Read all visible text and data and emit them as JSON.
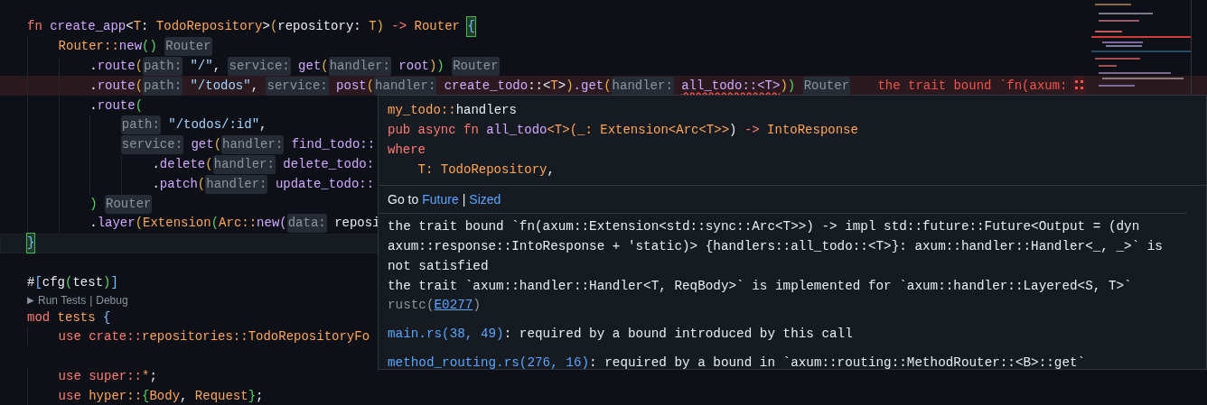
{
  "editor": {
    "lines": [
      {
        "kind": "code",
        "error": false,
        "current": false,
        "tokens": [
          {
            "text": "fn ",
            "kind": "kw"
          },
          {
            "text": "create_app",
            "kind": "fn"
          },
          {
            "text": "<",
            "kind": "p"
          },
          {
            "text": "T",
            "kind": "ty"
          },
          {
            "text": ": ",
            "kind": "p"
          },
          {
            "text": "TodoRepository",
            "kind": "ty"
          },
          {
            "text": ">",
            "kind": "p"
          },
          {
            "text": "(",
            "kind": "g"
          },
          {
            "text": "repository: ",
            "kind": "p"
          },
          {
            "text": "T",
            "kind": "ty"
          },
          {
            "text": ") ",
            "kind": "g"
          },
          {
            "text": "-> ",
            "kind": "kw"
          },
          {
            "text": "Router ",
            "kind": "ty"
          },
          {
            "text": "{",
            "kind": "hl"
          }
        ]
      },
      {
        "kind": "code",
        "error": false,
        "current": false,
        "tokens": [
          {
            "text": "    Router::",
            "kind": "ty"
          },
          {
            "text": "new",
            "kind": "fn"
          },
          {
            "text": "() ",
            "kind": "gr"
          },
          {
            "text": "Router",
            "kind": "hint"
          }
        ]
      },
      {
        "kind": "code",
        "error": false,
        "current": false,
        "tokens": [
          {
            "text": "        .",
            "kind": "p"
          },
          {
            "text": "route",
            "kind": "fn"
          },
          {
            "text": "(",
            "kind": "g"
          },
          {
            "text": "path:",
            "kind": "hint"
          },
          {
            "text": "\"/\"",
            "kind": "str"
          },
          {
            "text": ", ",
            "kind": "p"
          },
          {
            "text": "service:",
            "kind": "hint"
          },
          {
            "text": "get",
            "kind": "fn"
          },
          {
            "text": "(",
            "kind": "g"
          },
          {
            "text": "handler:",
            "kind": "hint"
          },
          {
            "text": "root",
            "kind": "fn"
          },
          {
            "text": ")",
            "kind": "g"
          },
          {
            "text": ") ",
            "kind": "gr"
          },
          {
            "text": "Router",
            "kind": "hint"
          }
        ]
      },
      {
        "kind": "code",
        "error": true,
        "current": false,
        "tokens": [
          {
            "text": "        .",
            "kind": "p"
          },
          {
            "text": "route",
            "kind": "fn"
          },
          {
            "text": "(",
            "kind": "g"
          },
          {
            "text": "path:",
            "kind": "hint"
          },
          {
            "text": "\"/todos\"",
            "kind": "str"
          },
          {
            "text": ", ",
            "kind": "p"
          },
          {
            "text": "service:",
            "kind": "hint"
          },
          {
            "text": "post",
            "kind": "fn"
          },
          {
            "text": "(",
            "kind": "g"
          },
          {
            "text": "handler:",
            "kind": "hint"
          },
          {
            "text": "create_todo",
            "kind": "fn"
          },
          {
            "text": "::<",
            "kind": "p"
          },
          {
            "text": "T",
            "kind": "ty"
          },
          {
            "text": ">",
            "kind": "p"
          },
          {
            "text": ")",
            "kind": "g"
          },
          {
            "text": ".get",
            "kind": "fn"
          },
          {
            "text": "(",
            "kind": "g"
          },
          {
            "text": "handler:",
            "kind": "hint"
          },
          {
            "text": "all_todo::<T>",
            "kind": "fn",
            "squiggle": true
          },
          {
            "text": ")",
            "kind": "g"
          },
          {
            "text": ") ",
            "kind": "gr"
          },
          {
            "text": "Router",
            "kind": "hint"
          },
          {
            "text": "the trait bound `fn(axum:",
            "kind": "diag"
          }
        ]
      },
      {
        "kind": "code",
        "error": false,
        "current": false,
        "tokens": [
          {
            "text": "        .",
            "kind": "p"
          },
          {
            "text": "route",
            "kind": "fn"
          },
          {
            "text": "(",
            "kind": "gr"
          }
        ]
      },
      {
        "kind": "code",
        "error": false,
        "current": false,
        "tokens": [
          {
            "text": "            path:",
            "kind": "hint"
          },
          {
            "text": "\"/todos/:id\"",
            "kind": "str"
          },
          {
            "text": ",",
            "kind": "p"
          }
        ]
      },
      {
        "kind": "code",
        "error": false,
        "current": false,
        "tokens": [
          {
            "text": "            service:",
            "kind": "hint"
          },
          {
            "text": "get",
            "kind": "fn"
          },
          {
            "text": "(",
            "kind": "g"
          },
          {
            "text": "handler:",
            "kind": "hint"
          },
          {
            "text": "find_todo::",
            "kind": "fn"
          }
        ]
      },
      {
        "kind": "code",
        "error": false,
        "current": false,
        "tokens": [
          {
            "text": "                .",
            "kind": "p"
          },
          {
            "text": "delete",
            "kind": "fn"
          },
          {
            "text": "(",
            "kind": "g"
          },
          {
            "text": "handler:",
            "kind": "hint"
          },
          {
            "text": "delete_todo:",
            "kind": "fn"
          }
        ]
      },
      {
        "kind": "code",
        "error": false,
        "current": false,
        "tokens": [
          {
            "text": "                .",
            "kind": "p"
          },
          {
            "text": "patch",
            "kind": "fn"
          },
          {
            "text": "(",
            "kind": "g"
          },
          {
            "text": "handler:",
            "kind": "hint"
          },
          {
            "text": "update_todo::",
            "kind": "fn"
          }
        ]
      },
      {
        "kind": "code",
        "error": false,
        "current": false,
        "tokens": [
          {
            "text": "        ) ",
            "kind": "gr"
          },
          {
            "text": "Router",
            "kind": "hint"
          }
        ]
      },
      {
        "kind": "code",
        "error": false,
        "current": false,
        "tokens": [
          {
            "text": "        .",
            "kind": "p"
          },
          {
            "text": "layer",
            "kind": "fn"
          },
          {
            "text": "(",
            "kind": "g"
          },
          {
            "text": "Extension",
            "kind": "ty"
          },
          {
            "text": "(",
            "kind": "gr"
          },
          {
            "text": "Arc::",
            "kind": "ty"
          },
          {
            "text": "new",
            "kind": "fn"
          },
          {
            "text": "(",
            "kind": "v"
          },
          {
            "text": "data:",
            "kind": "hint"
          },
          {
            "text": "reposi",
            "kind": "p"
          }
        ]
      },
      {
        "kind": "code",
        "error": false,
        "current": true,
        "tokens": [
          {
            "text": "}",
            "kind": "hl"
          }
        ]
      },
      {
        "kind": "blank"
      },
      {
        "kind": "code",
        "error": false,
        "current": false,
        "tokens": [
          {
            "text": "#",
            "kind": "p"
          },
          {
            "text": "[",
            "kind": "b"
          },
          {
            "text": "cfg",
            "kind": "p"
          },
          {
            "text": "(",
            "kind": "gr"
          },
          {
            "text": "test",
            "kind": "p"
          },
          {
            "text": ")",
            "kind": "gr"
          },
          {
            "text": "]",
            "kind": "b"
          }
        ]
      },
      {
        "kind": "codelens",
        "icon": "▶",
        "links": [
          "Run Tests",
          "Debug"
        ],
        "separator": "|"
      },
      {
        "kind": "code",
        "error": false,
        "current": false,
        "tokens": [
          {
            "text": "mod ",
            "kind": "kw"
          },
          {
            "text": "tests ",
            "kind": "ty"
          },
          {
            "text": "{",
            "kind": "b"
          }
        ]
      },
      {
        "kind": "code",
        "error": false,
        "current": false,
        "tokens": [
          {
            "text": "    use crate::",
            "kind": "kw"
          },
          {
            "text": "repositories::TodoRepositoryFo",
            "kind": "ty"
          }
        ]
      },
      {
        "kind": "blank"
      },
      {
        "kind": "code",
        "error": false,
        "current": false,
        "tokens": [
          {
            "text": "    use super::",
            "kind": "kw"
          },
          {
            "text": "*",
            "kind": "ty"
          },
          {
            "text": ";",
            "kind": "p"
          }
        ]
      },
      {
        "kind": "code",
        "error": false,
        "current": false,
        "tokens": [
          {
            "text": "    use ",
            "kind": "kw"
          },
          {
            "text": "hyper::",
            "kind": "ty"
          },
          {
            "text": "{",
            "kind": "gr"
          },
          {
            "text": "Body",
            "kind": "ty"
          },
          {
            "text": ", ",
            "kind": "p"
          },
          {
            "text": "Request",
            "kind": "ty"
          },
          {
            "text": "}",
            "kind": "gr"
          },
          {
            "text": ";",
            "kind": "p"
          }
        ]
      }
    ]
  },
  "hover": {
    "signature": [
      [
        {
          "text": "my_todo::",
          "kind": "ty"
        },
        {
          "text": "handlers",
          "kind": "p"
        }
      ],
      [
        {
          "text": "pub async fn ",
          "kind": "kw"
        },
        {
          "text": "all_todo",
          "kind": "fn"
        },
        {
          "text": "<T>(_: ",
          "kind": "ty"
        },
        {
          "text": "Extension<Arc<T>>",
          "kind": "ty"
        },
        {
          "text": ") ",
          "kind": "p"
        },
        {
          "text": "-> ",
          "kind": "kw"
        },
        {
          "text": "IntoResponse",
          "kind": "ty"
        }
      ],
      [
        {
          "text": "where",
          "kind": "kw"
        }
      ],
      [
        {
          "text": "    T: TodoRepository",
          "kind": "ty"
        },
        {
          "text": ",",
          "kind": "p"
        }
      ]
    ],
    "goto": {
      "label": "Go to",
      "links": [
        "Future",
        "Sized"
      ],
      "separator": "|"
    },
    "messages": [
      {
        "text": "the trait bound `fn(axum::Extension<std::sync::Arc<T>>) -> impl std::future::Future<Output = (dyn axum::response::IntoResponse + 'static)> {handlers::all_todo::<T>}: axum::handler::Handler<_, _>` is not satisfied"
      },
      {
        "text": "the trait `axum::handler::Handler<T, ReqBody>` is implemented for `axum::handler::Layered<S, T>`",
        "source": "rustc(",
        "code": "E0277",
        "source_end": ")"
      }
    ],
    "related": [
      {
        "location": "main.rs(38, 49)",
        "text": ": required by a bound introduced by this call"
      },
      {
        "location": "method_routing.rs(276, 16)",
        "text": ": required by a bound in `axum::routing::MethodRouter::<B>::get`"
      }
    ]
  }
}
